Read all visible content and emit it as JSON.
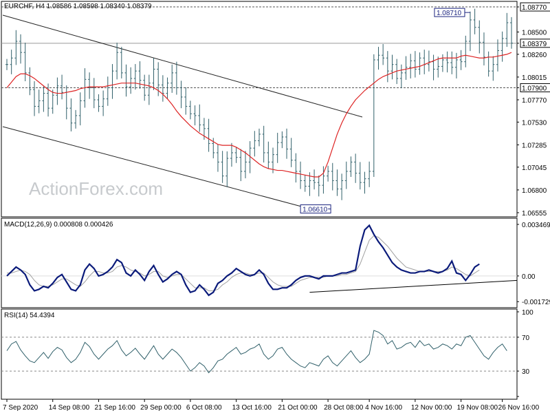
{
  "watermark": "ActionForex.com",
  "colors": {
    "price": "#2f5f69",
    "ma": "#dd2222",
    "macd_line": "#0a1a7a",
    "macd_signal": "#a0a0a0",
    "rsi": "#2f5f69",
    "channel": "#222222",
    "grid_level": "#555555",
    "callout_border": "#1a237e"
  },
  "chart_data": [
    {
      "type": "line",
      "panel": "price",
      "title": "EURCHF, H4  1.08586 1.08598 1.08340 1.08379",
      "y_ticks": [
        "1.08770",
        "1.08500",
        "1.08379",
        "1.08260",
        "1.08015",
        "1.07900",
        "1.07770",
        "1.07530",
        "1.07285",
        "1.07045",
        "1.06800",
        "1.06555"
      ],
      "ylim": [
        1.0654,
        1.088
      ],
      "current_price": "1.08379",
      "levels": [
        {
          "label": "1.08770",
          "value": 1.0877
        },
        {
          "label": "1.07900",
          "value": 1.079
        },
        {
          "label": "1.08379",
          "value": 1.08379
        }
      ],
      "callouts": [
        {
          "label": "1.08710",
          "value": 1.0871,
          "bar_index": 101
        },
        {
          "label": "1.06610",
          "value": 1.0661,
          "bar_index": 70
        }
      ],
      "series": [
        {
          "name": "",
          "close": [
            1.0815,
            1.0822,
            1.084,
            1.0828,
            1.0806,
            1.0788,
            1.077,
            1.0776,
            1.0784,
            1.0768,
            1.0782,
            1.0792,
            1.0785,
            1.0768,
            1.0752,
            1.076,
            1.0776,
            1.0799,
            1.079,
            1.0777,
            1.077,
            1.0778,
            1.079,
            1.0808,
            1.0828,
            1.0806,
            1.0791,
            1.08,
            1.0808,
            1.0798,
            1.0782,
            1.0795,
            1.081,
            1.0793,
            1.0784,
            1.0795,
            1.0806,
            1.079,
            1.078,
            1.077,
            1.0762,
            1.076,
            1.075,
            1.0746,
            1.073,
            1.072,
            1.071,
            1.0695,
            1.0714,
            1.072,
            1.0715,
            1.07,
            1.071,
            1.0725,
            1.0733,
            1.074,
            1.072,
            1.071,
            1.0718,
            1.0731,
            1.0737,
            1.0724,
            1.0712,
            1.07,
            1.069,
            1.0684,
            1.069,
            1.0688,
            1.0685,
            1.0695,
            1.07,
            1.069,
            1.0681,
            1.069,
            1.07,
            1.071,
            1.0698,
            1.0688,
            1.0692,
            1.07,
            1.082,
            1.0825,
            1.0822,
            1.0808,
            1.0815,
            1.08,
            1.0806,
            1.0812,
            1.0819,
            1.081,
            1.0822,
            1.0815,
            1.0818,
            1.081,
            1.0813,
            1.082,
            1.0817,
            1.0812,
            1.082,
            1.0818,
            1.084,
            1.0863,
            1.0855,
            1.0839,
            1.0823,
            1.0808,
            1.0815,
            1.083,
            1.0843,
            1.086,
            1.0838
          ]
        },
        {
          "name": "",
          "values": [
            1.079,
            1.0796,
            1.0802,
            1.0805,
            1.0805,
            1.0803,
            1.08,
            1.0796,
            1.0792,
            1.0788,
            1.0785,
            1.0784,
            1.0784,
            1.0785,
            1.0786,
            1.0787,
            1.0789,
            1.079,
            1.0791,
            1.0791,
            1.0791,
            1.0791,
            1.0792,
            1.0793,
            1.0794,
            1.0795,
            1.0795,
            1.0795,
            1.0795,
            1.0794,
            1.0793,
            1.0792,
            1.079,
            1.0787,
            1.0783,
            1.0778,
            1.0772,
            1.0765,
            1.0759,
            1.0754,
            1.0749,
            1.0745,
            1.0741,
            1.0738,
            1.0735,
            1.0732,
            1.0729,
            1.0728,
            1.0728,
            1.0728,
            1.0726,
            1.0723,
            1.072,
            1.0716,
            1.0712,
            1.0708,
            1.0705,
            1.0703,
            1.0702,
            1.0701,
            1.0701,
            1.07,
            1.0699,
            1.0698,
            1.0697,
            1.0696,
            1.0695,
            1.0694,
            1.0694,
            1.0698,
            1.071,
            1.0725,
            1.074,
            1.0752,
            1.0762,
            1.077,
            1.0777,
            1.0782,
            1.0787,
            1.0791,
            1.0795,
            1.0799,
            1.0802,
            1.0804,
            1.0806,
            1.0808,
            1.0809,
            1.081,
            1.0811,
            1.0812,
            1.0813,
            1.0815,
            1.0817,
            1.0819,
            1.0821,
            1.0822,
            1.0822,
            1.0822,
            1.0822,
            1.0824,
            1.0825,
            1.0824,
            1.0823,
            1.0822,
            1.0822,
            1.0823,
            1.0823,
            1.0824,
            1.0825,
            1.0826,
            1.0828
          ]
        }
      ]
    },
    {
      "type": "line",
      "panel": "macd",
      "title": "MACD(12,26,9) 0.000808 0.000426",
      "y_ticks": [
        "0.003469",
        "0.00",
        "-0.001729"
      ],
      "ylim": [
        -0.00195,
        0.0037
      ],
      "series": [
        {
          "name": "",
          "values": [
            0.0,
            0.0003,
            0.0006,
            0.0004,
            0.0001,
            -0.0006,
            -0.001,
            -0.0009,
            -0.0007,
            -0.0008,
            -0.0005,
            -0.0001,
            0.0001,
            -0.0004,
            -0.0009,
            -0.001,
            -0.0006,
            0.0004,
            0.0008,
            0.0005,
            0.0,
            0.0001,
            0.0003,
            0.0006,
            0.0011,
            0.0009,
            0.0002,
            0.0,
            0.0004,
            0.0001,
            -0.0003,
            0.0003,
            0.0007,
            0.0001,
            -0.0004,
            -0.0002,
            0.0001,
            0.0003,
            0.0001,
            -0.0006,
            -0.0011,
            -0.001,
            -0.0006,
            -0.0009,
            -0.0013,
            -0.0011,
            -0.0005,
            -0.0003,
            0.0,
            0.0002,
            0.0005,
            0.0003,
            0.0001,
            0.0,
            0.0001,
            0.0004,
            0.0001,
            -0.0005,
            -0.0009,
            -0.0009,
            -0.0008,
            -0.0008,
            -0.0006,
            -0.0003,
            -0.0001,
            0.0,
            0.0,
            -0.0001,
            -0.0002,
            0.0,
            0.0,
            0.0,
            0.0001,
            0.0002,
            0.0002,
            0.0003,
            0.0004,
            0.002,
            0.0031,
            0.0034,
            0.0028,
            0.0023,
            0.0019,
            0.0014,
            0.0009,
            0.0006,
            0.0004,
            0.0003,
            0.0002,
            0.0002,
            0.0003,
            0.0003,
            0.0004,
            0.0003,
            0.0002,
            0.0003,
            0.0005,
            0.001,
            0.0002,
            0.0001,
            -0.0003,
            0.0001,
            0.0006,
            0.0008
          ]
        },
        {
          "name": "",
          "values": [
            0.0002,
            0.0002,
            0.0003,
            0.0004,
            0.0003,
            0.0001,
            -0.0003,
            -0.0006,
            -0.0007,
            -0.0007,
            -0.0006,
            -0.0004,
            -0.0002,
            -0.0002,
            -0.0004,
            -0.0006,
            -0.0007,
            -0.0004,
            0.0,
            0.0003,
            0.0003,
            0.0002,
            0.0002,
            0.0003,
            0.0006,
            0.0007,
            0.0006,
            0.0004,
            0.0003,
            0.0002,
            0.0,
            0.0001,
            0.0003,
            0.0003,
            0.0,
            -0.0001,
            0.0,
            0.0001,
            0.0001,
            -0.0002,
            -0.0005,
            -0.0008,
            -0.0008,
            -0.0008,
            -0.001,
            -0.001,
            -0.0009,
            -0.0006,
            -0.0004,
            -0.0001,
            0.0001,
            0.0002,
            0.0002,
            0.0001,
            0.0001,
            0.0002,
            0.0002,
            -0.0001,
            -0.0004,
            -0.0006,
            -0.0007,
            -0.0007,
            -0.0007,
            -0.0005,
            -0.0003,
            -0.0002,
            -0.0001,
            -0.0001,
            -0.0001,
            -0.0001,
            0.0,
            0.0,
            0.0,
            0.0001,
            0.0001,
            0.0002,
            0.0003,
            0.0008,
            0.0016,
            0.0024,
            0.0027,
            0.0026,
            0.0023,
            0.002,
            0.0016,
            0.0012,
            0.0009,
            0.0006,
            0.0005,
            0.0004,
            0.0003,
            0.0003,
            0.0003,
            0.0003,
            0.0003,
            0.0003,
            0.0004,
            0.0006,
            0.0005,
            0.0003,
            0.0001,
            0.0,
            0.0002,
            0.0004
          ]
        }
      ],
      "trendline": [
        {
          "bar_index": 66,
          "value": -0.0011
        },
        {
          "bar_index": 110,
          "value": -0.0003
        }
      ]
    },
    {
      "type": "line",
      "panel": "rsi",
      "title": "RSI(14) 54.4394",
      "y_ticks": [
        "100",
        "70",
        "30",
        "0"
      ],
      "ylim": [
        0,
        100
      ],
      "levels": [
        70,
        30
      ],
      "series": [
        {
          "name": "",
          "values": [
            54,
            62,
            65,
            55,
            48,
            42,
            40,
            46,
            52,
            45,
            53,
            58,
            55,
            46,
            40,
            44,
            52,
            64,
            59,
            50,
            44,
            50,
            56,
            60,
            66,
            55,
            48,
            52,
            57,
            50,
            44,
            52,
            60,
            50,
            44,
            50,
            56,
            52,
            46,
            38,
            30,
            34,
            40,
            36,
            28,
            34,
            42,
            44,
            50,
            54,
            58,
            50,
            52,
            56,
            58,
            62,
            50,
            44,
            48,
            56,
            58,
            50,
            44,
            40,
            36,
            34,
            40,
            38,
            36,
            44,
            48,
            40,
            36,
            42,
            48,
            54,
            46,
            40,
            44,
            50,
            78,
            76,
            72,
            62,
            66,
            56,
            58,
            62,
            64,
            58,
            66,
            60,
            62,
            56,
            58,
            62,
            60,
            56,
            62,
            60,
            70,
            72,
            64,
            56,
            48,
            44,
            52,
            58,
            62,
            54
          ]
        }
      ]
    }
  ],
  "x_ticks": [
    {
      "label": "7 Sep 2020",
      "bar": 0
    },
    {
      "label": "14 Sep 08:00",
      "bar": 10
    },
    {
      "label": "21 Sep 16:00",
      "bar": 20
    },
    {
      "label": "29 Sep 00:00",
      "bar": 30
    },
    {
      "label": "6 Oct 08:00",
      "bar": 40
    },
    {
      "label": "13 Oct 16:00",
      "bar": 50
    },
    {
      "label": "21 Oct 00:00",
      "bar": 60
    },
    {
      "label": "28 Oct 08:00",
      "bar": 70
    },
    {
      "label": "4 Nov 16:00",
      "bar": 79
    },
    {
      "label": "12 Nov 00:00",
      "bar": 89
    },
    {
      "label": "19 Nov 08:00",
      "bar": 99
    },
    {
      "label": "26 Nov 16:00",
      "bar": 108
    }
  ]
}
